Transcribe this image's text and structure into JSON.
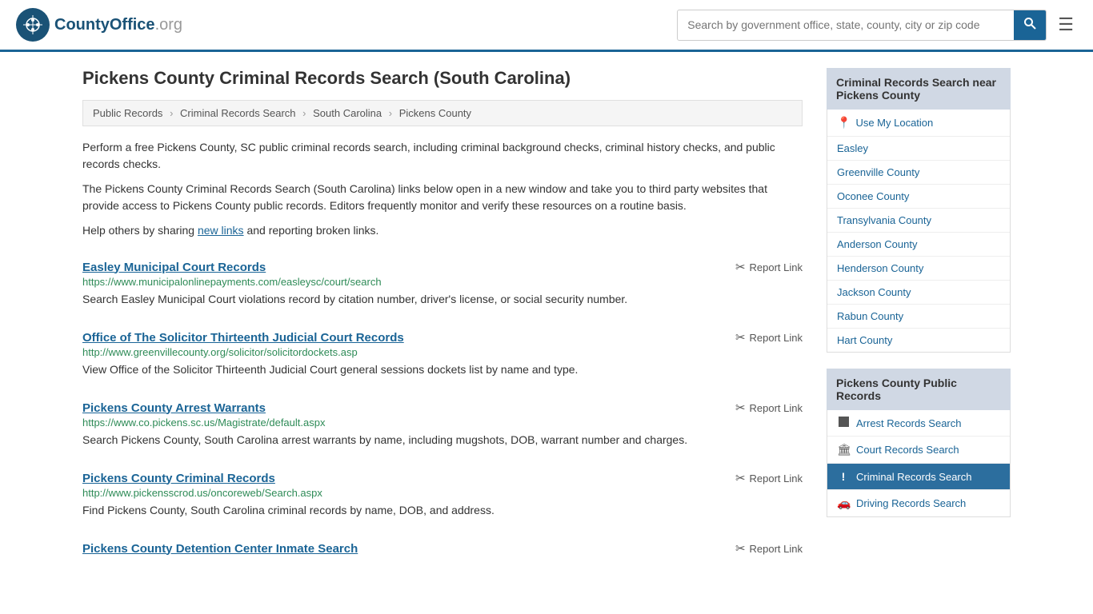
{
  "header": {
    "logo_text": "CountyOffice",
    "logo_suffix": ".org",
    "search_placeholder": "Search by government office, state, county, city or zip code",
    "search_button_label": "🔍"
  },
  "page": {
    "title": "Pickens County Criminal Records Search (South Carolina)",
    "breadcrumb": {
      "items": [
        "Public Records",
        "Criminal Records Search",
        "South Carolina",
        "Pickens County"
      ]
    },
    "description1": "Perform a free Pickens County, SC public criminal records search, including criminal background checks, criminal history checks, and public records checks.",
    "description2": "The Pickens County Criminal Records Search (South Carolina) links below open in a new window and take you to third party websites that provide access to Pickens County public records. Editors frequently monitor and verify these resources on a routine basis.",
    "description3_pre": "Help others by sharing ",
    "description3_link": "new links",
    "description3_post": " and reporting broken links.",
    "results": [
      {
        "title": "Easley Municipal Court Records",
        "url": "https://www.municipalonlinepayments.com/easleysc/court/search",
        "desc": "Search Easley Municipal Court violations record by citation number, driver's license, or social security number."
      },
      {
        "title": "Office of The Solicitor Thirteenth Judicial Court Records",
        "url": "http://www.greenvillecounty.org/solicitor/solicitordockets.asp",
        "desc": "View Office of the Solicitor Thirteenth Judicial Court general sessions dockets list by name and type."
      },
      {
        "title": "Pickens County Arrest Warrants",
        "url": "https://www.co.pickens.sc.us/Magistrate/default.aspx",
        "desc": "Search Pickens County, South Carolina arrest warrants by name, including mugshots, DOB, warrant number and charges."
      },
      {
        "title": "Pickens County Criminal Records",
        "url": "http://www.pickensscrod.us/oncoreweb/Search.aspx",
        "desc": "Find Pickens County, South Carolina criminal records by name, DOB, and address."
      },
      {
        "title": "Pickens County Detention Center Inmate Search",
        "url": "",
        "desc": ""
      }
    ],
    "report_link_label": "Report Link"
  },
  "sidebar": {
    "section1": {
      "header": "Criminal Records Search near Pickens County",
      "use_location": "Use My Location",
      "locations": [
        "Easley",
        "Greenville County",
        "Oconee County",
        "Transylvania County",
        "Anderson County",
        "Henderson County",
        "Jackson County",
        "Rabun County",
        "Hart County"
      ]
    },
    "section2": {
      "header": "Pickens County Public Records",
      "items": [
        {
          "label": "Arrest Records Search",
          "icon": "square",
          "active": false
        },
        {
          "label": "Court Records Search",
          "icon": "building",
          "active": false
        },
        {
          "label": "Criminal Records Search",
          "icon": "exclaim",
          "active": true
        },
        {
          "label": "Driving Records Search",
          "icon": "car",
          "active": false
        }
      ]
    }
  }
}
